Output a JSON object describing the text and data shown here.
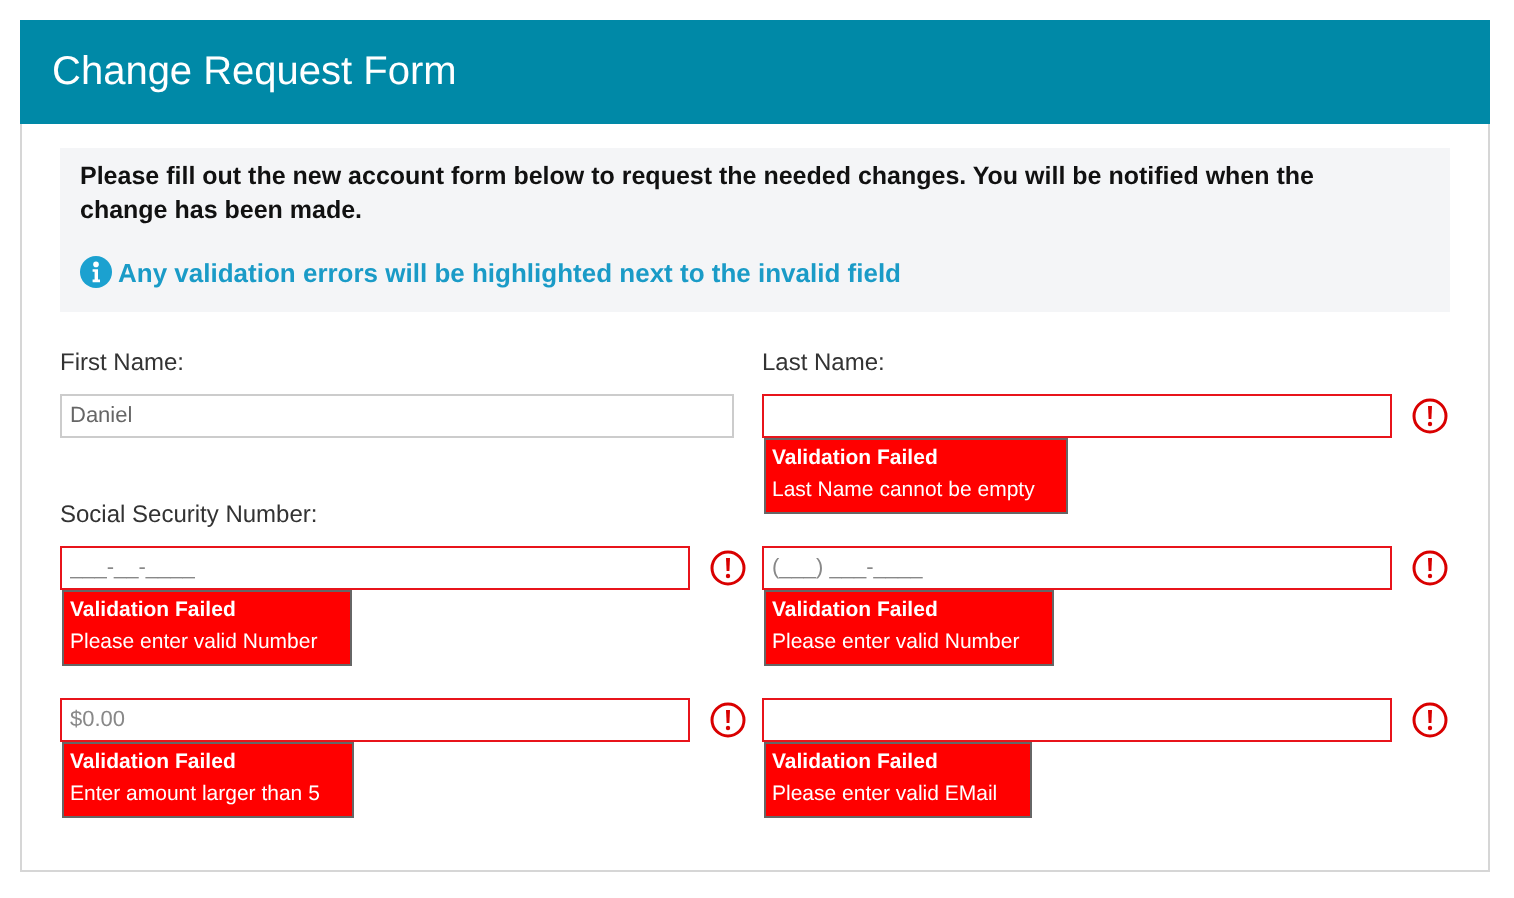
{
  "window": {
    "title": "Change Request Form"
  },
  "intro": {
    "text": "Please fill out the new account form below to request the needed changes. You will be notified when the change has been made.",
    "note": "Any validation errors will be highlighted next to the invalid field"
  },
  "fields": [
    {
      "label": "First Name:",
      "value": "Daniel",
      "invalid": false
    },
    {
      "label": "Last Name:",
      "invalid": true,
      "error": {
        "title": "Validation Failed",
        "message": "Last Name cannot be empty"
      }
    },
    {
      "label": "Social Security Number:",
      "placeholder": "___-__-____",
      "invalid": true,
      "error": {
        "title": "Validation Failed",
        "message": "Please enter valid Number"
      }
    },
    {
      "placeholder": "(___) ___-____",
      "invalid": true,
      "error": {
        "title": "Validation Failed",
        "message": "Please enter valid Number"
      }
    },
    {
      "placeholder": "$0.00",
      "invalid": true,
      "error": {
        "title": "Validation Failed",
        "message": "Enter amount larger than 5"
      }
    },
    {
      "invalid": true,
      "error": {
        "title": "Validation Failed",
        "message": "Please enter valid EMail"
      }
    }
  ]
}
